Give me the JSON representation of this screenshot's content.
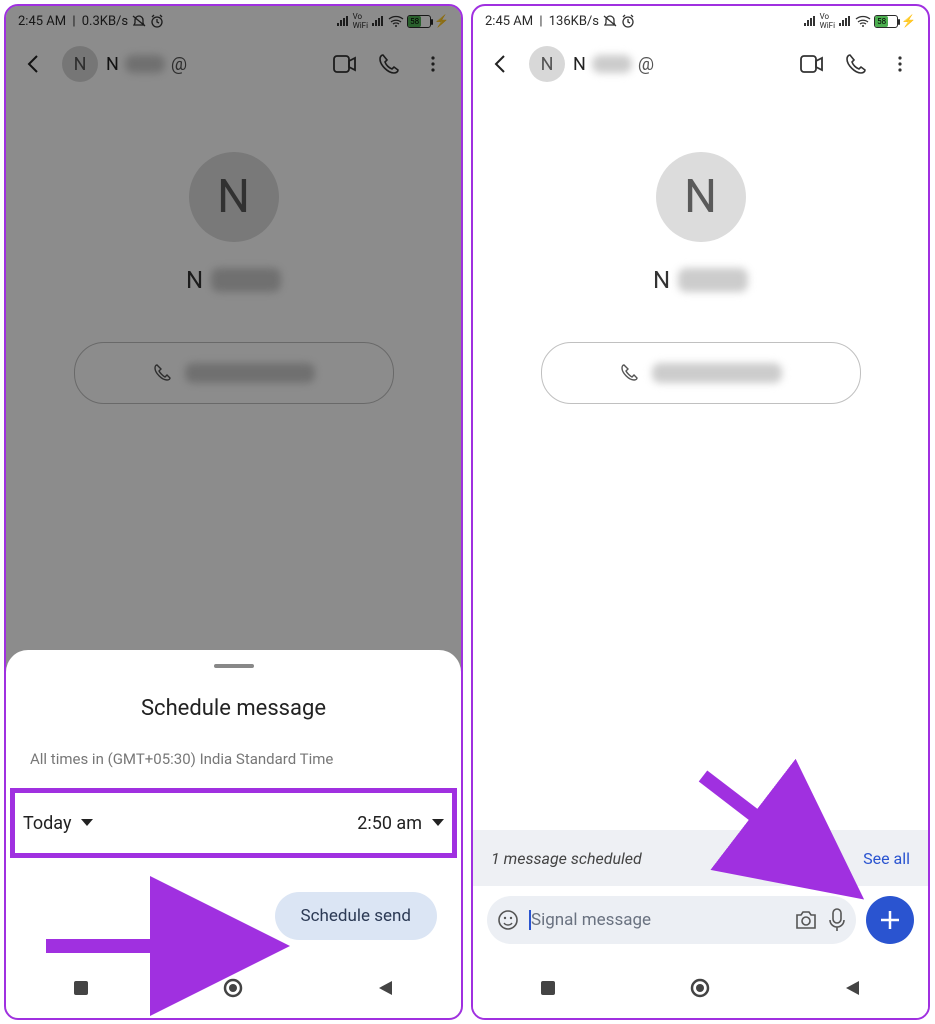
{
  "left": {
    "status": {
      "time": "2:45 AM",
      "net": "0.3KB/s",
      "battery": "58"
    },
    "header": {
      "initial": "N",
      "name_prefix": "N"
    },
    "contact": {
      "initial": "N",
      "name_prefix": "N"
    },
    "sheet": {
      "title": "Schedule message",
      "subtitle": "All times in (GMT+05:30) India Standard Time",
      "day": "Today",
      "time": "2:50 am",
      "button": "Schedule send"
    }
  },
  "right": {
    "status": {
      "time": "2:45 AM",
      "net": "136KB/s",
      "battery": "58"
    },
    "header": {
      "initial": "N",
      "name_prefix": "N"
    },
    "contact": {
      "initial": "N",
      "name_prefix": "N"
    },
    "banner": {
      "text": "1 message scheduled",
      "link": "See all"
    },
    "compose": {
      "placeholder": "Signal message"
    }
  }
}
